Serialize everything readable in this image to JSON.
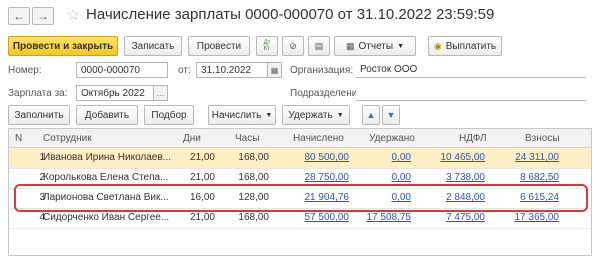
{
  "window": {
    "title": "Начисление зарплаты 0000-000070 от 31.10.2022 23:59:59"
  },
  "toolbar": {
    "post_close": "Провести и закрыть",
    "save": "Записать",
    "post": "Провести",
    "dt_kt": "Дт\nКт",
    "reports": "Отчеты",
    "pay": "Выплатить"
  },
  "form": {
    "number_label": "Номер:",
    "number_value": "0000-000070",
    "date_label": "от:",
    "date_value": "31.10.2022",
    "org_label": "Организация:",
    "org_value": "Росток ООО",
    "salary_for_label": "Зарплата за:",
    "salary_for_value": "Октябрь 2022",
    "department_label": "Подразделение:",
    "department_value": ""
  },
  "table_toolbar": {
    "fill": "Заполнить",
    "add": "Добавить",
    "select": "Подбор",
    "accrue": "Начислить",
    "withhold": "Удержать"
  },
  "table": {
    "columns": [
      "N",
      "Сотрудник",
      "Дни",
      "Часы",
      "Начислено",
      "Удержано",
      "НДФЛ",
      "Взносы"
    ],
    "rows": [
      {
        "n": "1",
        "employee": "Иванова Ирина Николаев...",
        "days": "21,00",
        "hours": "168,00",
        "accrued": "80 500,00",
        "withheld": "0,00",
        "ndfl": "10 465,00",
        "contrib": "24 311,00",
        "selected": true
      },
      {
        "n": "2",
        "employee": "Королькова Елена Степа...",
        "days": "21,00",
        "hours": "168,00",
        "accrued": "28 750,00",
        "withheld": "0,00",
        "ndfl": "3 738,00",
        "contrib": "8 682,50",
        "selected": false
      },
      {
        "n": "3",
        "employee": "Ларионова Светлана Вик...",
        "days": "16,00",
        "hours": "128,00",
        "accrued": "21 904,76",
        "withheld": "0,00",
        "ndfl": "2 848,00",
        "contrib": "6 615,24",
        "selected": false
      },
      {
        "n": "4",
        "employee": "Сидорченко Иван Сергее...",
        "days": "21,00",
        "hours": "168,00",
        "accrued": "57 500,00",
        "withheld": "17 508,75",
        "ndfl": "7 475,00",
        "contrib": "17 365,00",
        "selected": false
      }
    ]
  },
  "colors": {
    "primary_button": "#f3c81c",
    "selected_row": "#fbefc3",
    "highlight": "#d8393b",
    "link": "#2a55c0"
  }
}
